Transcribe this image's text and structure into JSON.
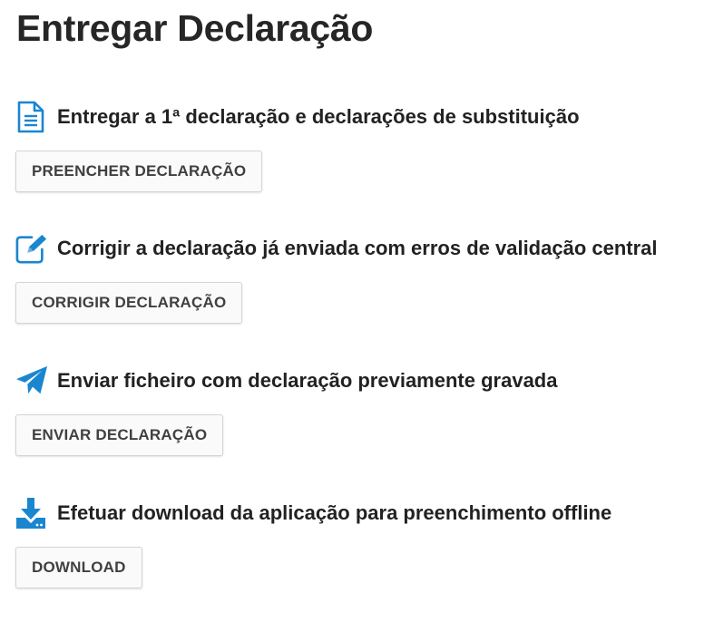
{
  "page": {
    "title": "Entregar Declaração"
  },
  "sections": [
    {
      "icon": "document-icon",
      "title": "Entregar a 1ª declaração e declarações de substituição",
      "button": "PREENCHER DECLARAÇÃO"
    },
    {
      "icon": "edit-icon",
      "title": "Corrigir a declaração já enviada com erros de validação central",
      "button": "CORRIGIR DECLARAÇÃO"
    },
    {
      "icon": "paper-plane-icon",
      "title": "Enviar ficheiro com declaração previamente gravada",
      "button": "ENVIAR DECLARAÇÃO"
    },
    {
      "icon": "download-icon",
      "title": "Efetuar download da aplicação para preenchimento offline",
      "button": "DOWNLOAD"
    }
  ],
  "colors": {
    "icon_accent": "#1a86d0",
    "button_bg": "#fafafa",
    "button_border": "#d4d4d4",
    "text": "#222222"
  }
}
